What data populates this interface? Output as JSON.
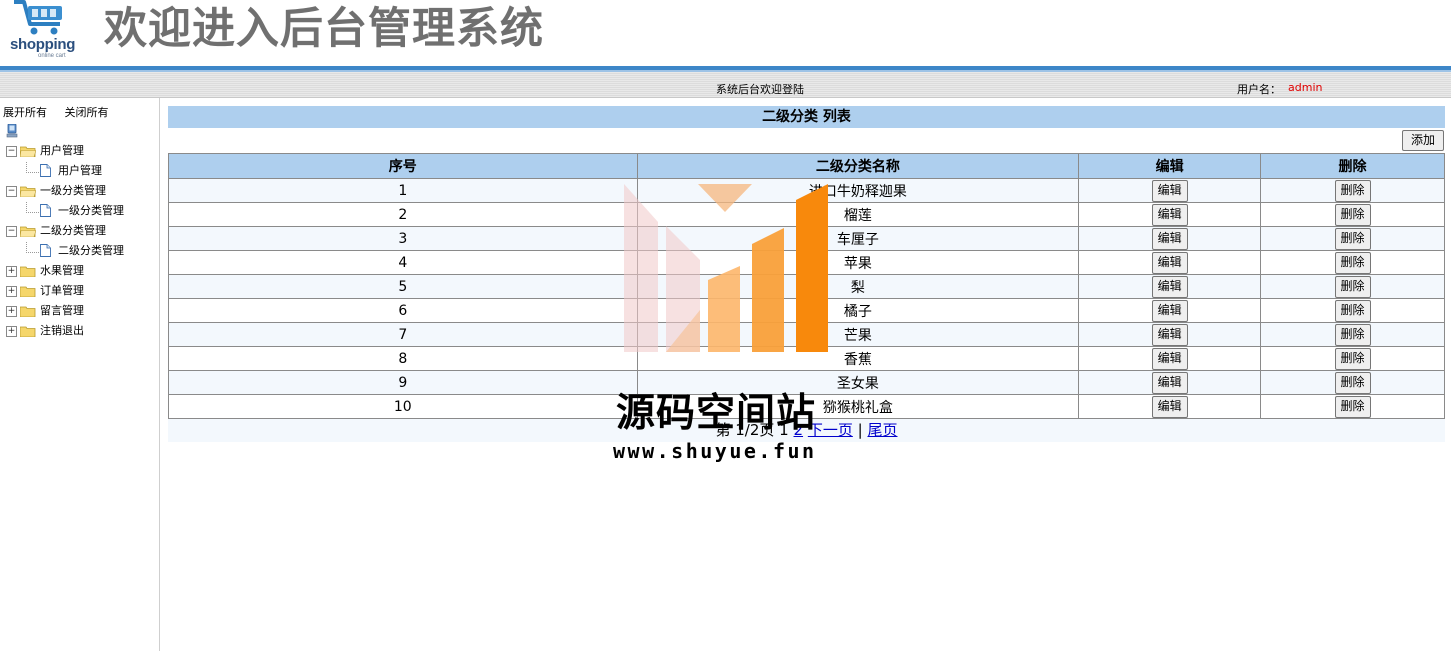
{
  "header": {
    "logo_text": "shopping",
    "logo_sub": "online cart",
    "title": "欢迎进入后台管理系统"
  },
  "statusbar": {
    "welcome": "系统后台欢迎登陆",
    "user_label": "用户名：",
    "username": "admin"
  },
  "sidebar": {
    "expand_all": "展开所有",
    "collapse_all": "关闭所有",
    "nodes": [
      {
        "label": "用户管理",
        "expanded": true,
        "child": "用户管理"
      },
      {
        "label": "一级分类管理",
        "expanded": true,
        "child": "一级分类管理"
      },
      {
        "label": "二级分类管理",
        "expanded": true,
        "child": "二级分类管理"
      },
      {
        "label": "水果管理",
        "expanded": false
      },
      {
        "label": "订单管理",
        "expanded": false
      },
      {
        "label": "留言管理",
        "expanded": false
      },
      {
        "label": "注销退出",
        "expanded": false
      }
    ]
  },
  "main": {
    "list_title": "二级分类 列表",
    "add_label": "添加",
    "columns": [
      "序号",
      "二级分类名称",
      "编辑",
      "删除"
    ],
    "edit_label": "编辑",
    "delete_label": "删除",
    "rows": [
      {
        "no": "1",
        "name": "进口牛奶释迦果"
      },
      {
        "no": "2",
        "name": "榴莲"
      },
      {
        "no": "3",
        "name": "车厘子"
      },
      {
        "no": "4",
        "name": "苹果"
      },
      {
        "no": "5",
        "name": "梨"
      },
      {
        "no": "6",
        "name": "橘子"
      },
      {
        "no": "7",
        "name": "芒果"
      },
      {
        "no": "8",
        "name": "香蕉"
      },
      {
        "no": "9",
        "name": "圣女果"
      },
      {
        "no": "10",
        "name": "猕猴桃礼盒"
      }
    ],
    "pager": {
      "info": "第 1/2页 1 ",
      "page2": "2",
      "next": "下一页",
      "sep": "|",
      "last": "尾页"
    }
  },
  "watermark": {
    "text": "源码空间站",
    "url": "www.shuyue.fun"
  },
  "colors": {
    "header_bar": "#aecfee",
    "accent_line": "#3d86c8",
    "username": "#e00000",
    "title_gray": "#707070"
  }
}
